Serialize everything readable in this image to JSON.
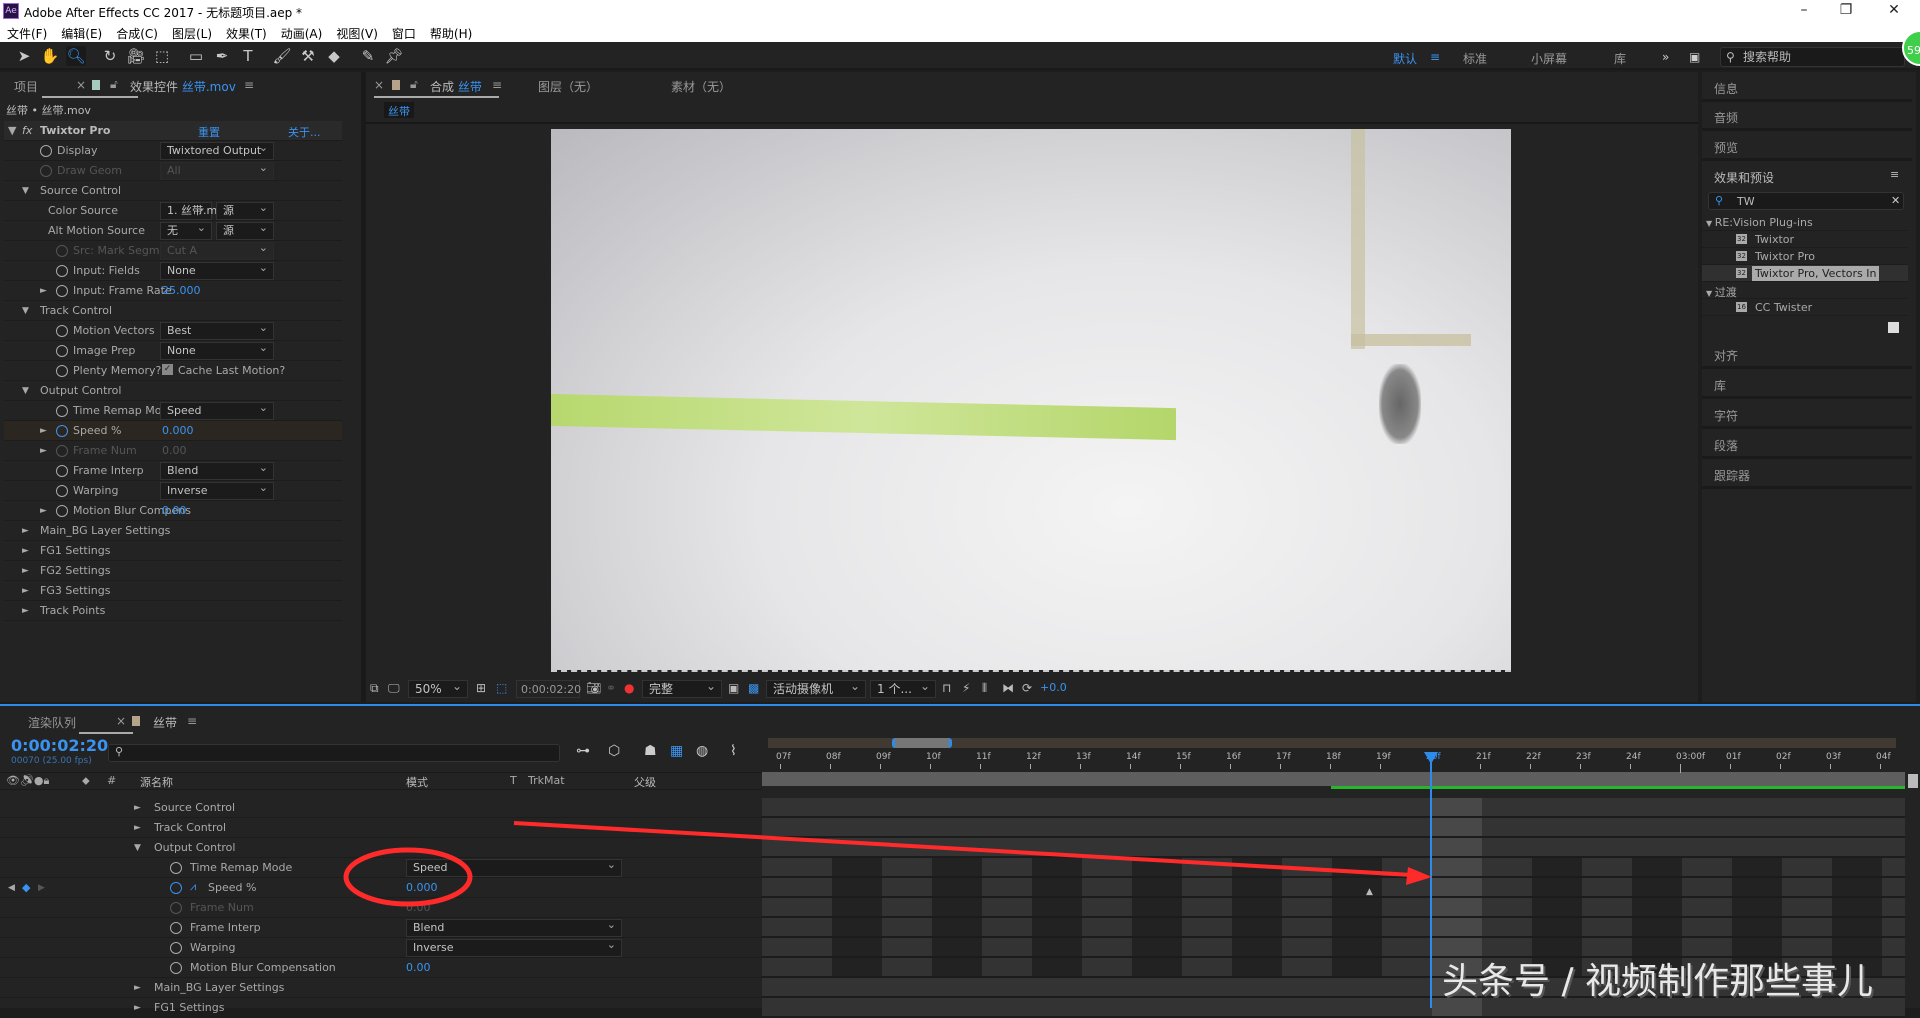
{
  "app": {
    "title": "Adobe After Effects CC 2017 - 无标题项目.aep *",
    "logo": "Ae",
    "badge": "59"
  },
  "menu": [
    "文件(F)",
    "编辑(E)",
    "合成(C)",
    "图层(L)",
    "效果(T)",
    "动画(A)",
    "视图(V)",
    "窗口",
    "帮助(H)"
  ],
  "toolbar": {
    "tools": [
      "selection-tool",
      "hand-tool",
      "zoom-tool",
      "rotate-tool",
      "camera-tool",
      "pan-behind-tool",
      "rectangle-tool",
      "pen-tool",
      "type-tool",
      "brush-tool",
      "clone-stamp-tool",
      "eraser-tool",
      "roto-brush-tool",
      "puppet-pin-tool"
    ],
    "workspaces": [
      "默认",
      "标准",
      "小屏幕",
      "库"
    ],
    "active_workspace": "默认",
    "search_placeholder": "搜索帮助"
  },
  "left_panel": {
    "tab_project": "项目",
    "tab_effects": "效果控件",
    "tab_effects_layer": "丝带.mov",
    "breadcrumb": "丝带 • 丝带.mov",
    "effect": {
      "name": "Twixtor Pro",
      "reset": "重置",
      "about": "关于..."
    },
    "rows": [
      {
        "label": "Display",
        "level": 1,
        "sw": true,
        "dd": "Twixtored Output"
      },
      {
        "label": "Draw Geom",
        "level": 1,
        "sw": true,
        "dd": "All",
        "dim": true
      },
      {
        "label": "Source Control",
        "level": 0,
        "tri": "▼"
      },
      {
        "label": "Color Source",
        "level": 2,
        "dd": "1. 丝带.m",
        "dd2": "源"
      },
      {
        "label": "Alt Motion Source",
        "level": 2,
        "dd": "无",
        "dd2": "源"
      },
      {
        "label": "Src: Mark Segments",
        "level": 2,
        "sw": true,
        "dd": "Cut A",
        "dim": true
      },
      {
        "label": "Input: Fields",
        "level": 2,
        "sw": true,
        "dd": "None"
      },
      {
        "label": "Input: Frame Rate",
        "level": 2,
        "sw": true,
        "tri": "►",
        "val": "25.000"
      },
      {
        "label": "Track Control",
        "level": 0,
        "tri": "▼"
      },
      {
        "label": "Motion Vectors",
        "level": 2,
        "sw": true,
        "dd": "Best"
      },
      {
        "label": "Image Prep",
        "level": 2,
        "sw": true,
        "dd": "None"
      },
      {
        "label": "Plenty Memory?",
        "level": 2,
        "sw": true,
        "check": "Cache Last Motion?"
      },
      {
        "label": "Output Control",
        "level": 0,
        "tri": "▼"
      },
      {
        "label": "Time Remap Mode",
        "level": 2,
        "sw": true,
        "dd": "Speed"
      },
      {
        "label": "Speed %",
        "level": 2,
        "sw": true,
        "tri": "►",
        "val": "0.000",
        "active": true
      },
      {
        "label": "Frame Num",
        "level": 2,
        "sw": true,
        "tri": "►",
        "val": "0.00",
        "dim": true
      },
      {
        "label": "Frame Interp",
        "level": 2,
        "sw": true,
        "dd": "Blend"
      },
      {
        "label": "Warping",
        "level": 2,
        "sw": true,
        "dd": "Inverse"
      },
      {
        "label": "Motion Blur Compens",
        "level": 2,
        "sw": true,
        "tri": "►",
        "val": "0.00"
      },
      {
        "label": "Main_BG Layer Settings",
        "level": 0,
        "tri": "►"
      },
      {
        "label": "FG1 Settings",
        "level": 0,
        "tri": "►"
      },
      {
        "label": "FG2 Settings",
        "level": 0,
        "tri": "►"
      },
      {
        "label": "FG3 Settings",
        "level": 0,
        "tri": "►"
      },
      {
        "label": "Track Points",
        "level": 0,
        "tri": "►"
      }
    ]
  },
  "viewer": {
    "tab_comp": "合成",
    "tab_comp_name": "丝带",
    "tab_layer": "图层（无）",
    "tab_footage": "素材（无）",
    "comp_chip": "丝带",
    "zoom": "50%",
    "timecode": "0:00:02:20",
    "resolution": "完整",
    "camera": "活动摄像机",
    "views": "1 个...",
    "exposure": "+0.0"
  },
  "right_panel": {
    "info": "信息",
    "audio": "音频",
    "preview": "预览",
    "effects_presets": "效果和预设",
    "search_value": "TW",
    "groups": [
      {
        "name": "RE:Vision Plug-ins",
        "items": [
          {
            "label": "Twixtor",
            "bits": "32"
          },
          {
            "label": "Twixtor Pro",
            "bits": "32"
          },
          {
            "label": "Twixtor Pro, Vectors In",
            "bits": "32",
            "selected": true
          }
        ]
      },
      {
        "name": "过渡",
        "items": [
          {
            "label": "CC Twister",
            "bits": "16"
          }
        ]
      }
    ],
    "align": "对齐",
    "library": "库",
    "character": "字符",
    "paragraph": "段落",
    "tracker": "跟踪器"
  },
  "timeline": {
    "tab_render": "渲染队列",
    "tab_comp": "丝带",
    "timecode": "0:00:02:20",
    "frame_info": "00070 (25.00 fps)",
    "columns": {
      "source_name": "源名称",
      "mode": "模式",
      "t": "T",
      "trkmat": "TrkMat",
      "parent": "父级"
    },
    "ruler": [
      "07f",
      "08f",
      "09f",
      "10f",
      "11f",
      "12f",
      "13f",
      "14f",
      "15f",
      "16f",
      "17f",
      "18f",
      "19f",
      "20f",
      "21f",
      "22f",
      "23f",
      "24f",
      "03:00f",
      "01f",
      "02f",
      "03f",
      "04f"
    ],
    "current_label": "20f",
    "rows": [
      {
        "label": "Source Control",
        "level": 0,
        "tri": "►"
      },
      {
        "label": "Track Control",
        "level": 0,
        "tri": "►"
      },
      {
        "label": "Output Control",
        "level": 0,
        "tri": "▼"
      },
      {
        "label": "Time Remap Mode",
        "level": 1,
        "dd": "Speed"
      },
      {
        "label": "Speed %",
        "level": 1,
        "val": "0.000",
        "keyframed": true
      },
      {
        "label": "Frame Num",
        "level": 1,
        "val": "0.00",
        "dim": true
      },
      {
        "label": "Frame Interp",
        "level": 1,
        "dd": "Blend"
      },
      {
        "label": "Warping",
        "level": 1,
        "dd": "Inverse"
      },
      {
        "label": "Motion Blur Compensation",
        "level": 1,
        "val": "0.00"
      },
      {
        "label": "Main_BG Layer Settings",
        "level": 0,
        "tri": "►"
      },
      {
        "label": "FG1 Settings",
        "level": 0,
        "tri": "►"
      }
    ]
  },
  "watermark": "头条号 / 视频制作那些事儿",
  "colors": {
    "accent": "#3a93f0",
    "annotation": "#ff2b2b",
    "work_area": "#27b52b"
  }
}
